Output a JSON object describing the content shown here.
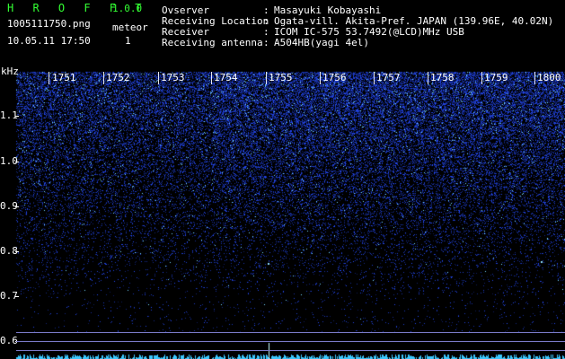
{
  "header": {
    "app_title": "H R O F F T",
    "app_version": "1.0.0",
    "filename": "1005111750.png",
    "timestamp": "10.05.11 17:50",
    "meteor_label": "meteor",
    "meteor_count": "1",
    "info": [
      {
        "label": "Ovserver",
        "value": "Masayuki Kobayashi"
      },
      {
        "label": "Receiving Location",
        "value": "Ogata-vill. Akita-Pref. JAPAN (139.96E, 40.02N)"
      },
      {
        "label": "Receiver",
        "value": "ICOM IC-575 53.7492(@LCD)MHz USB"
      },
      {
        "label": "Receiving antenna",
        "value": "A504HB(yagi 4el)"
      }
    ],
    "separator": ":"
  },
  "axes": {
    "freq_unit": "kHz",
    "time_labels": [
      "1751",
      "1752",
      "1753",
      "1754",
      "1755",
      "1756",
      "1757",
      "1758",
      "1759",
      "1800"
    ],
    "freq_labels": [
      "1.1",
      "1.0",
      "0.9",
      "0.8",
      "0.7",
      "0.6"
    ]
  },
  "colors": {
    "title_green": "#33ff33",
    "spectrogram_blue": "#1a2cff",
    "marker_line": "#7a7ac8",
    "signal_cyan": "#66e0ff"
  }
}
